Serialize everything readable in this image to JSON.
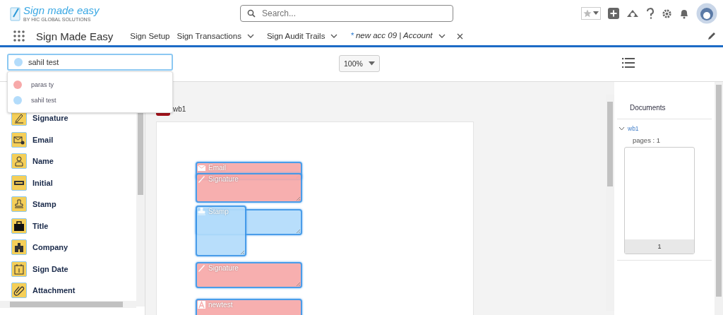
{
  "header": {
    "logo": {
      "title": "Sign made easy",
      "subtitle": "BY HIC GLOBAL SOLUTIONS"
    },
    "search": {
      "placeholder": "Search..."
    }
  },
  "nav": {
    "app_name": "Sign Made Easy",
    "tabs": [
      {
        "label": "Sign Setup",
        "has_menu": false,
        "closable": false,
        "selected": false
      },
      {
        "label": "Sign Transactions",
        "has_menu": true,
        "closable": false,
        "selected": false
      },
      {
        "label": "Sign Audit Trails",
        "has_menu": true,
        "closable": false,
        "selected": false
      },
      {
        "marker": "*",
        "label": "new acc 09 | Account",
        "has_menu": true,
        "closable": true,
        "selected": true
      }
    ]
  },
  "toolbar": {
    "signer": {
      "value": "sahil test",
      "color": "#b3dcfb"
    },
    "signer_options": [
      {
        "label": "paras ty",
        "color": "#f7a9a9"
      },
      {
        "label": "sahil test",
        "color": "#b3dcfb"
      }
    ],
    "zoom": "100%"
  },
  "fields_palette": [
    {
      "kind": "signature",
      "label": "Signature"
    },
    {
      "kind": "email",
      "label": "Email"
    },
    {
      "kind": "name",
      "label": "Name"
    },
    {
      "kind": "initial",
      "label": "Initial"
    },
    {
      "kind": "stamp",
      "label": "Stamp"
    },
    {
      "kind": "title",
      "label": "Title"
    },
    {
      "kind": "company",
      "label": "Company"
    },
    {
      "kind": "date",
      "label": "Sign Date"
    },
    {
      "kind": "attachment",
      "label": "Attachment"
    }
  ],
  "document": {
    "name": "wb1",
    "fields": [
      {
        "kind": "email",
        "label": "Email",
        "color": "#f7a9a9"
      },
      {
        "kind": "signature",
        "label": "Signature",
        "color": "#f7a9a9"
      },
      {
        "kind": "signature",
        "color": "#b3dcfb"
      },
      {
        "kind": "stamp",
        "label": "Stamp",
        "color": "#b3dcfb"
      },
      {
        "kind": "signature",
        "label": "Signature",
        "color": "#f7a9a9"
      },
      {
        "kind": "text",
        "label": "newtest",
        "color": "#f7a9a9"
      }
    ]
  },
  "documents_panel": {
    "title": "Documents",
    "items": [
      {
        "name": "wb1",
        "expanded": true,
        "pages_label": "pages : 1",
        "thumbnails": [
          {
            "label": "1"
          }
        ]
      }
    ]
  }
}
